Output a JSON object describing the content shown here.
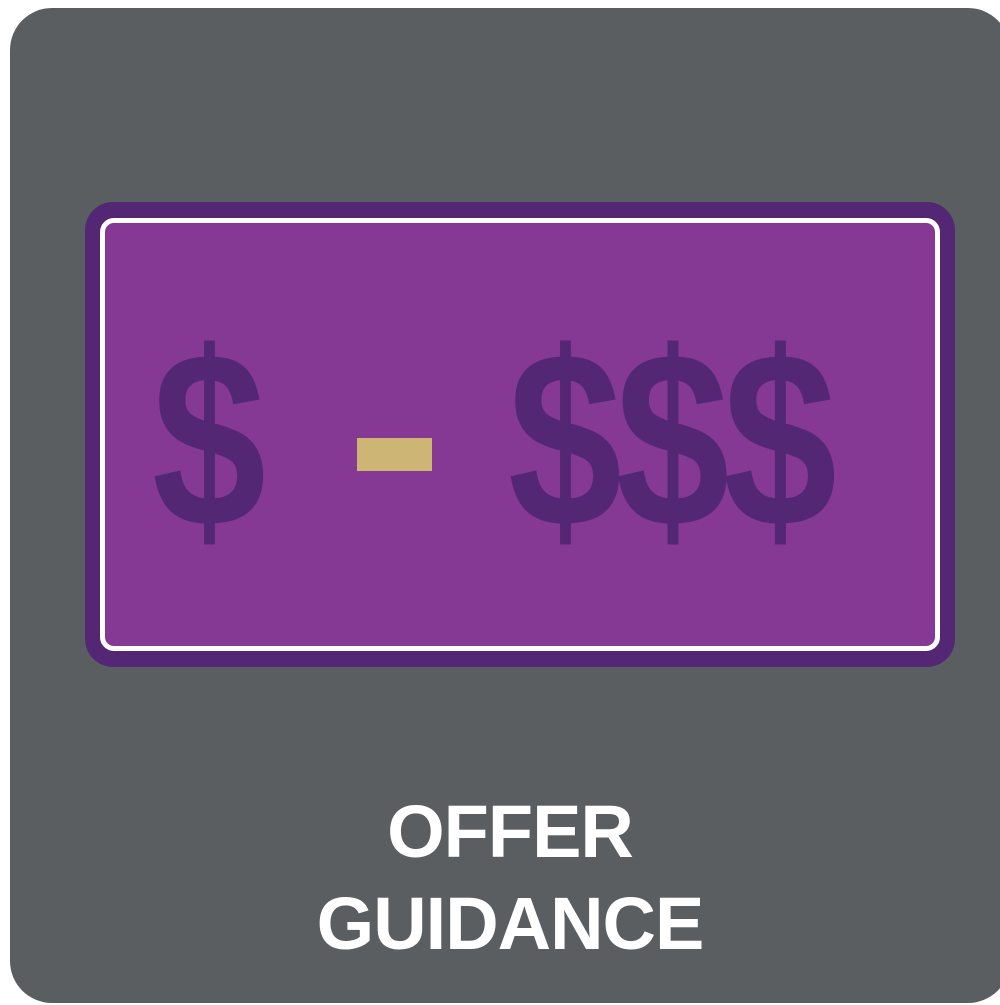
{
  "price_range": {
    "low": "$",
    "separator": "-",
    "high": "$$$"
  },
  "title": {
    "line1": "OFFER",
    "line2": "GUIDANCE"
  },
  "colors": {
    "tile_background": "#5b5e61",
    "banner_outer": "#542774",
    "banner_fill": "#853894",
    "banner_border": "#ffffff",
    "dollar_signs": "#542774",
    "dash": "#cdb675",
    "label": "#ffffff"
  }
}
